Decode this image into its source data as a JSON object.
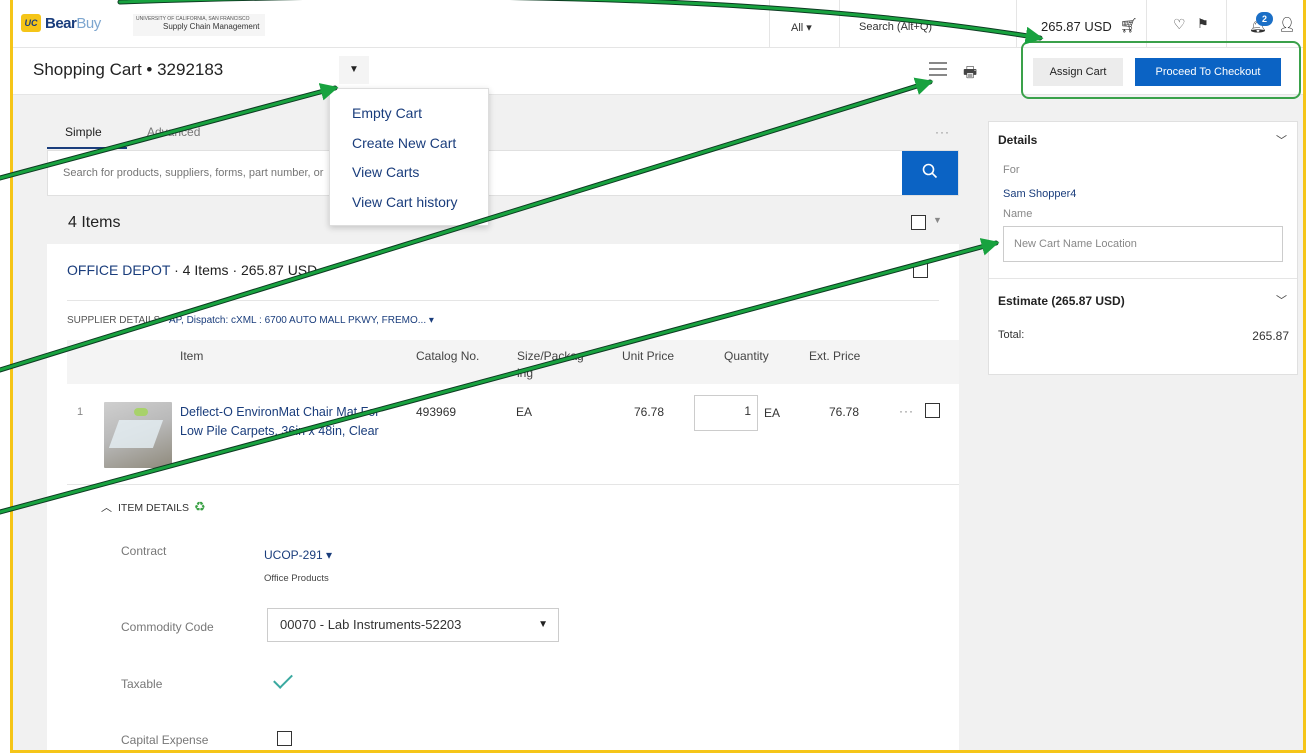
{
  "topbar": {
    "logo_badge": "UC",
    "logo_text_1": "Bear",
    "logo_text_2": "Buy",
    "university_line1": "UNIVERSITY OF CALIFORNIA, SAN FRANCISCO",
    "university_line2": "Supply Chain Management",
    "search_scope": "All ▾",
    "search_label": "Search (Alt+Q)",
    "cart_total": "265.87 USD",
    "notification_count": "2"
  },
  "header": {
    "title": "Shopping Cart  •  3292183",
    "assign_label": "Assign Cart",
    "checkout_label": "Proceed To Checkout"
  },
  "cart_menu": {
    "items": [
      "Empty Cart",
      "Create New Cart",
      "View Carts",
      "View Cart history"
    ]
  },
  "tabs": {
    "simple": "Simple",
    "advanced": "Advanced"
  },
  "search": {
    "placeholder": "Search for products, suppliers, forms, part number, or"
  },
  "items_count": "4 Items",
  "supplier": {
    "name": "OFFICE DEPOT",
    "summary": " ·  4 Items  · 265.87 USD",
    "details_label": "SUPPLIER DETAILS",
    "details_value": "AP, Dispatch: cXML : 6700 AUTO MALL PKWY, FREMO...  ▾"
  },
  "table": {
    "headers": {
      "item": "Item",
      "catalog": "Catalog No.",
      "size": "Size/Packag ing",
      "unit_price": "Unit Price",
      "quantity": "Quantity",
      "ext_price": "Ext. Price"
    },
    "row": {
      "num": "1",
      "title": "Deflect-O EnvironMat Chair Mat For Low Pile Carpets, 36in x 48in, Clear",
      "catalog": "493969",
      "size": "EA",
      "unit_price": "76.78",
      "quantity": "1",
      "uom": "EA",
      "ext_price": "76.78"
    }
  },
  "item_details": {
    "toggle_label": "ITEM DETAILS",
    "contract_label": "Contract",
    "contract_value": "UCOP-291  ▾",
    "contract_sub": "Office Products",
    "commodity_label": "Commodity Code",
    "commodity_value": "00070 - Lab Instruments-52203",
    "taxable_label": "Taxable",
    "capital_label": "Capital Expense"
  },
  "right_panel": {
    "details_title": "Details",
    "for_label": "For",
    "for_value": "Sam Shopper4",
    "name_label": "Name",
    "name_placeholder": "New Cart Name Location",
    "estimate_title": "Estimate (265.87 USD)",
    "total_label": "Total:",
    "total_value": "265.87"
  },
  "colors": {
    "frame": "#f5c518",
    "primary": "#0b63c4",
    "link": "#1a3d7c",
    "annotation": "#3aa14a"
  }
}
